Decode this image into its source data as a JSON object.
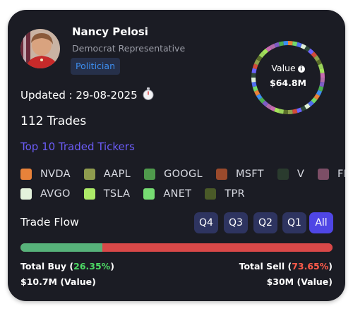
{
  "profile": {
    "name": "Nancy Pelosi",
    "role": "Democrat Representative",
    "badge": "Politician"
  },
  "updated": "Updated : 29-08-2025",
  "trades_count": "112 Trades",
  "top_tickers_label": "Top 10 Traded Tickers",
  "value_ring": {
    "label": "Value",
    "value": "$64.8M",
    "segment_colors": [
      "#e8823a",
      "#8fa04a",
      "#4caf50",
      "#6c63ff",
      "#b06aa8",
      "#e0f0d8",
      "#a4e35a",
      "#73d96a",
      "#5a6e2a",
      "#3d8ef0",
      "#d34b3a",
      "#7d5cc4",
      "#2f4a3a",
      "#c76bb0",
      "#4f6ef0",
      "#9bd45a"
    ]
  },
  "tickers": [
    {
      "symbol": "NVDA",
      "color": "#e8823a"
    },
    {
      "symbol": "AAPL",
      "color": "#8f9c4e"
    },
    {
      "symbol": "GOOGL",
      "color": "#4f9a4c"
    },
    {
      "symbol": "MSFT",
      "color": "#9a4a2c"
    },
    {
      "symbol": "V",
      "color": "#2a3b2e"
    },
    {
      "symbol": "FI",
      "color": "#7c4e66"
    },
    {
      "symbol": "AVGO",
      "color": "#e4f3dc"
    },
    {
      "symbol": "TSLA",
      "color": "#acea68"
    },
    {
      "symbol": "ANET",
      "color": "#76dc72"
    },
    {
      "symbol": "TPR",
      "color": "#4a5a28"
    }
  ],
  "trade_flow": {
    "title": "Trade Flow",
    "quarters": [
      "Q4",
      "Q3",
      "Q2",
      "Q1",
      "All"
    ],
    "active": "All",
    "buy_fraction": 0.2635,
    "total_buy_label": "Total Buy (",
    "total_buy_pct": "26.35%",
    "total_sell_label": "Total Sell (",
    "total_sell_pct": "73.65%",
    "close_paren": ")",
    "buy_value": "$10.7M (Value)",
    "sell_value": "$30M (Value)"
  },
  "icons": {
    "stopwatch": "stopwatch-icon",
    "info": "info-icon"
  }
}
